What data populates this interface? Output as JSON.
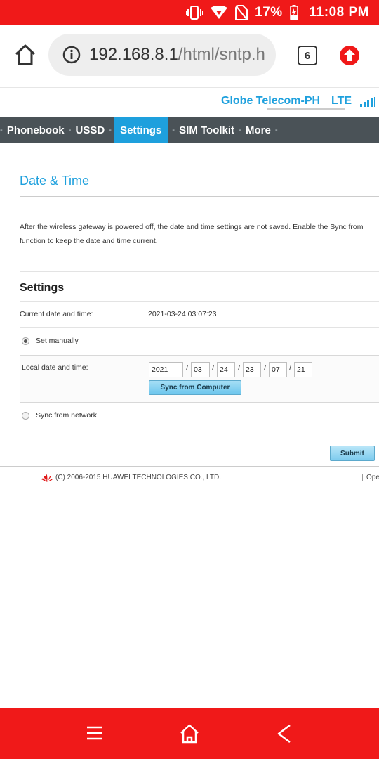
{
  "status_bar": {
    "battery_percent": "17%",
    "time": "11:08 PM",
    "icons": [
      "vibrate-icon",
      "wifi-signal-icon",
      "no-sim-icon",
      "battery-charging-icon"
    ]
  },
  "browser": {
    "url_host": "192.168.8.1",
    "url_path": "/html/sntp.h",
    "tab_count": "6",
    "icons": [
      "home-icon",
      "info-icon",
      "tabs-icon",
      "update-icon"
    ]
  },
  "header": {
    "carrier": "Globe Telecom-PH",
    "network_type": "LTE"
  },
  "nav": {
    "items": [
      {
        "label": "Phonebook"
      },
      {
        "label": "USSD"
      },
      {
        "label": "Settings",
        "active": true
      },
      {
        "label": "SIM Toolkit"
      },
      {
        "label": "More"
      }
    ]
  },
  "main": {
    "title": "Date & Time",
    "description": "After the wireless gateway is powered off, the date and time settings are not saved. Enable the Sync from function to keep the date and time current.",
    "section_title": "Settings",
    "current_label": "Current date and time:",
    "current_value": "2021-03-24 03:07:23",
    "option_manual": "Set manually",
    "option_network": "Sync from network",
    "selected_option": "Set manually",
    "local_label": "Local date and time:",
    "local": {
      "year": "2021",
      "month": "03",
      "day": "24",
      "hour": "23",
      "minute": "07",
      "second": "21"
    },
    "sync_button": "Sync from Computer",
    "submit_button": "Submit"
  },
  "footer": {
    "copyright": "(C) 2006-2015 HUAWEI TECHNOLOGIES CO., LTD.",
    "link": "Ope"
  },
  "colors": {
    "status_bar": "#f01919",
    "accent": "#1ea0dd",
    "nav_bg": "#4a5257"
  }
}
